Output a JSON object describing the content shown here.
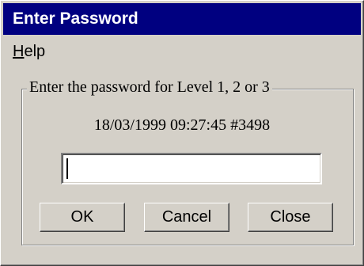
{
  "window": {
    "title": "Enter Password"
  },
  "menu": {
    "help": {
      "accel": "H",
      "rest": "elp"
    }
  },
  "group": {
    "legend": "Enter the password for Level 1, 2 or 3"
  },
  "stamp": "18/03/1999 09:27:45 #3498",
  "password": {
    "value": ""
  },
  "buttons": {
    "ok": "OK",
    "cancel": "Cancel",
    "close": "Close"
  },
  "colors": {
    "titlebar": "#000080",
    "face": "#d4d0c8"
  }
}
